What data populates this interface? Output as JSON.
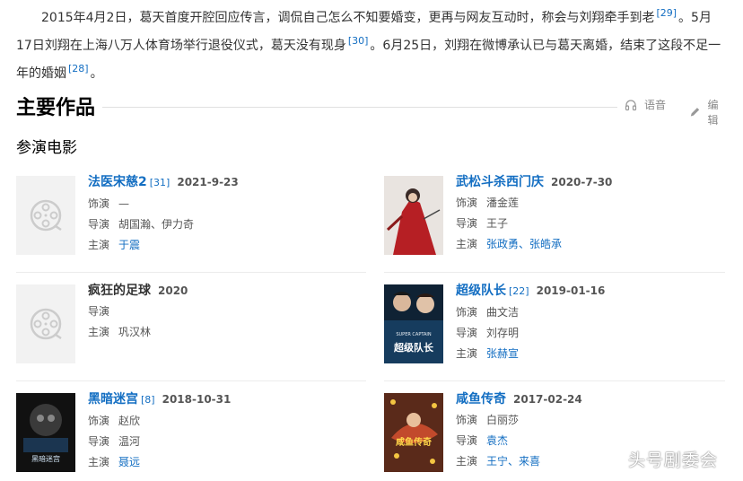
{
  "intro": {
    "seg1": "2015年4月2日，葛天首度开腔回应传言，调侃自己怎么不知要婚变，更再与网友互动时，称会与刘翔牵手到老",
    "ref1": "[29]",
    "seg2": "。5月17日刘翔在上海八万人体育场举行退役仪式，葛天没有现身",
    "ref2": "[30]",
    "seg3": "。6月25日，刘翔在微博承认已与葛天离婚，结束了这段不足一年的婚姻",
    "ref3": "[28]",
    "seg4": "。"
  },
  "section": {
    "title": "主要作品",
    "voice_label": "语音",
    "edit_label": "编辑",
    "subtitle": "参演电影"
  },
  "labels": {
    "role": "饰演",
    "director": "导演",
    "cast": "主演"
  },
  "films": [
    {
      "title": "法医宋慈2",
      "ref": "[31]",
      "date": "2021-9-23",
      "role": "—",
      "director": "胡国瀚、伊力奇",
      "cast": "于震"
    },
    {
      "title": "武松斗杀西门庆",
      "ref": "",
      "date": "2020-7-30",
      "role": "潘金莲",
      "director": "王子",
      "cast": "张政勇、张皓承"
    },
    {
      "title": "疯狂的足球",
      "ref": "",
      "date": "2020",
      "role": "",
      "director": "",
      "cast": "巩汉林"
    },
    {
      "title": "超级队长",
      "ref": "[22]",
      "date": "2019-01-16",
      "role": "曲文洁",
      "director": "刘存明",
      "cast": "张赫宣"
    },
    {
      "title": "黑暗迷宫",
      "ref": "[8]",
      "date": "2018-10-31",
      "role": "赵欣",
      "director": "温河",
      "cast": "聂远"
    },
    {
      "title": "咸鱼传奇",
      "ref": "",
      "date": "2017-02-24",
      "role": "白丽莎",
      "director": "袁杰",
      "cast": "王宁、来喜"
    }
  ],
  "posters": {
    "captain_en": "SUPER CAPTAIN",
    "captain_cn": "超级队长",
    "maze_cn": "黑暗迷宫",
    "fish_cn": "咸鱼传奇"
  },
  "watermark": "头号剧委会",
  "colors": {
    "link": "#136ec2",
    "text": "#333333",
    "placeholder": "#f2f2f2"
  }
}
